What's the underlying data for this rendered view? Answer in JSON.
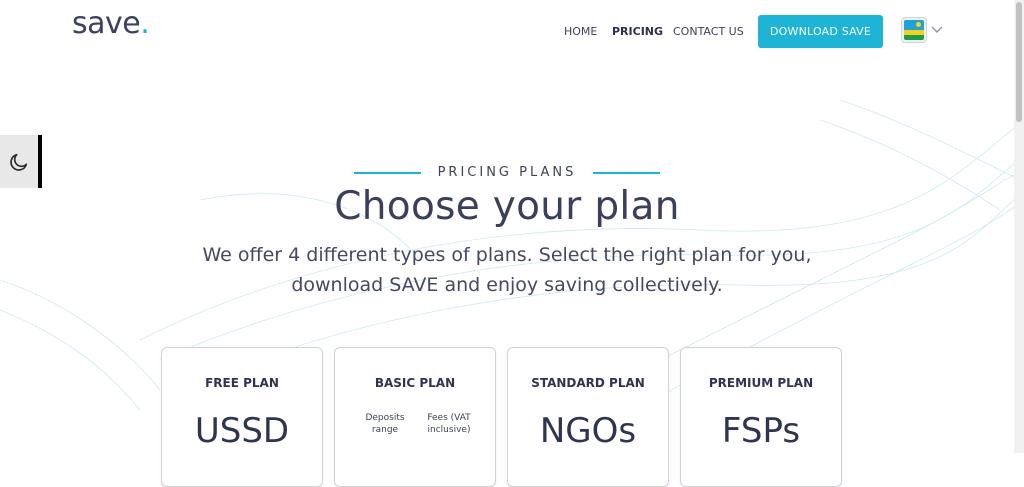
{
  "header": {
    "logo_text": "save",
    "logo_dot": ".",
    "nav": {
      "home": "HOME",
      "pricing": "PRICING",
      "contact": "CONTACT US"
    },
    "download_button": "DOWNLOAD SAVE",
    "language_flag": "rwanda-flag-icon"
  },
  "dark_mode_toggle": "moon-icon",
  "hero": {
    "eyebrow": "PRICING PLANS",
    "title": "Choose your plan",
    "subtitle": "We offer 4 different types of plans. Select the right plan for you, download SAVE and enjoy saving collectively."
  },
  "plans": [
    {
      "name": "FREE PLAN",
      "value": "USSD"
    },
    {
      "name": "BASIC PLAN",
      "col_left": "Deposits range",
      "col_right": "Fees (VAT inclusive)"
    },
    {
      "name": "STANDARD PLAN",
      "value": "NGOs"
    },
    {
      "name": "PREMIUM PLAN",
      "value": "FSPs"
    }
  ],
  "colors": {
    "accent": "#1db4d6",
    "text_dark": "#3a3f5c"
  }
}
